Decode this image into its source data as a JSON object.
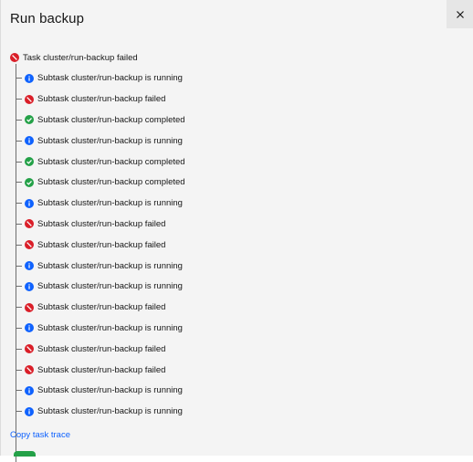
{
  "modal": {
    "title": "Run backup",
    "close_label": "Close"
  },
  "colors": {
    "failed": "#da1e28",
    "running": "#0f62fe",
    "completed": "#24a148",
    "link": "#0f62fe",
    "modal_bg": "#f4f4f4"
  },
  "task": {
    "status": "failed",
    "icon": "failed-icon",
    "text": "Task cluster/run-backup failed"
  },
  "subtasks": [
    {
      "status": "running",
      "icon": "info-icon",
      "text": "Subtask cluster/run-backup is running"
    },
    {
      "status": "failed",
      "icon": "failed-icon",
      "text": "Subtask cluster/run-backup failed"
    },
    {
      "status": "completed",
      "icon": "checkmark-icon",
      "text": "Subtask cluster/run-backup completed"
    },
    {
      "status": "running",
      "icon": "info-icon",
      "text": "Subtask cluster/run-backup is running"
    },
    {
      "status": "completed",
      "icon": "checkmark-icon",
      "text": "Subtask cluster/run-backup completed"
    },
    {
      "status": "completed",
      "icon": "checkmark-icon",
      "text": "Subtask cluster/run-backup completed"
    },
    {
      "status": "running",
      "icon": "info-icon",
      "text": "Subtask cluster/run-backup is running"
    },
    {
      "status": "failed",
      "icon": "failed-icon",
      "text": "Subtask cluster/run-backup failed"
    },
    {
      "status": "failed",
      "icon": "failed-icon",
      "text": "Subtask cluster/run-backup failed"
    },
    {
      "status": "running",
      "icon": "info-icon",
      "text": "Subtask cluster/run-backup is running"
    },
    {
      "status": "running",
      "icon": "info-icon",
      "text": "Subtask cluster/run-backup is running"
    },
    {
      "status": "failed",
      "icon": "failed-icon",
      "text": "Subtask cluster/run-backup failed"
    },
    {
      "status": "running",
      "icon": "info-icon",
      "text": "Subtask cluster/run-backup is running"
    },
    {
      "status": "failed",
      "icon": "failed-icon",
      "text": "Subtask cluster/run-backup failed"
    },
    {
      "status": "failed",
      "icon": "failed-icon",
      "text": "Subtask cluster/run-backup failed"
    },
    {
      "status": "running",
      "icon": "info-icon",
      "text": "Subtask cluster/run-backup is running"
    },
    {
      "status": "running",
      "icon": "info-icon",
      "text": "Subtask cluster/run-backup is running"
    }
  ],
  "actions": {
    "copy_trace_label": "Copy task trace"
  }
}
